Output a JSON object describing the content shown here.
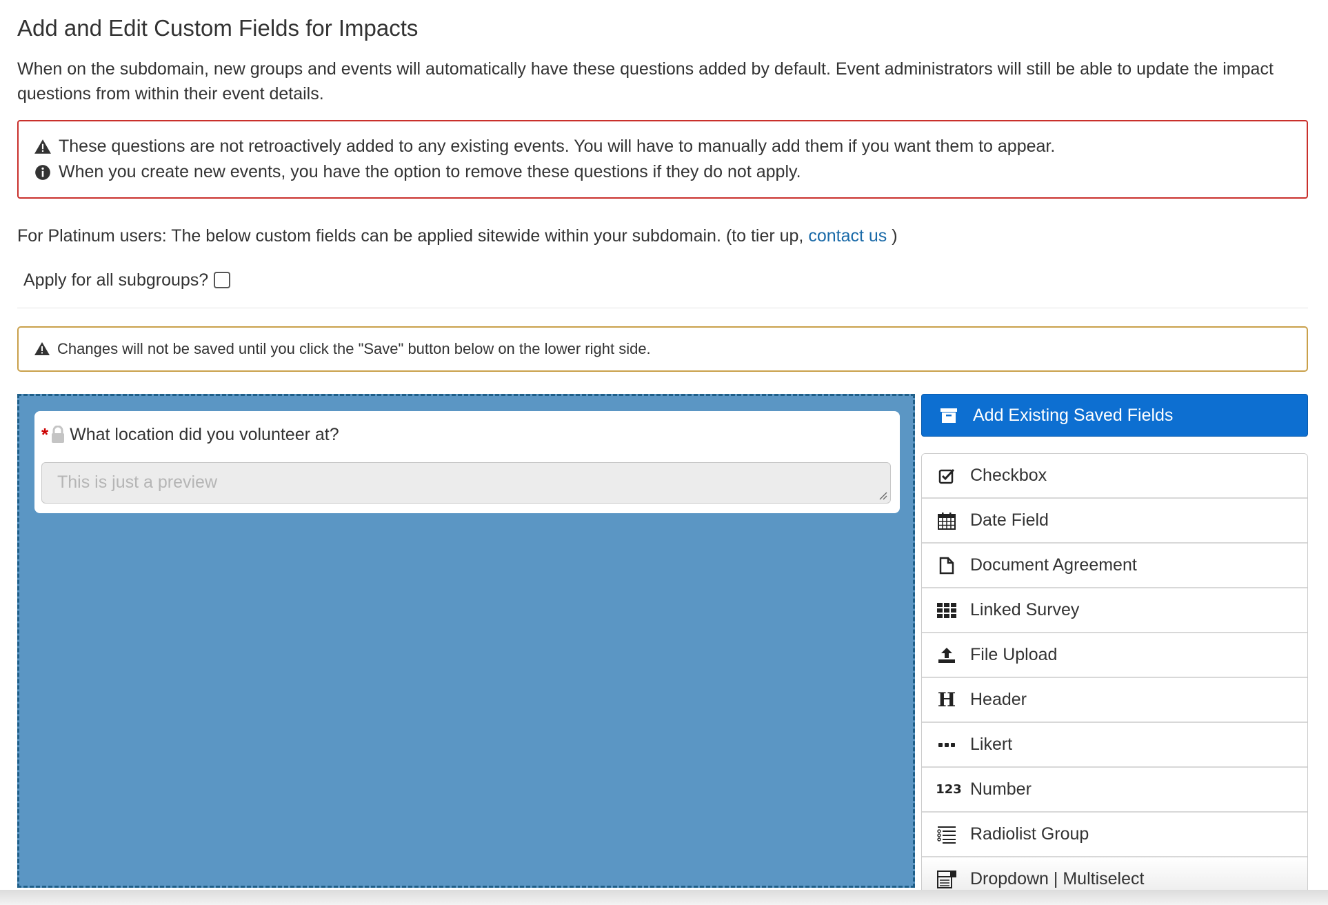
{
  "page": {
    "title": "Add and Edit Custom Fields for Impacts",
    "intro": "When on the subdomain, new groups and events will automatically have these questions added by default. Event administrators will still be able to update the impact questions from within their event details."
  },
  "notice": {
    "line1": "These questions are not retroactively added to any existing events. You will have to manually add them if you want them to appear.",
    "line2": "When you create new events, you have the option to remove these questions if they do not apply."
  },
  "platinum": {
    "text": "For Platinum users: The below custom fields can be applied sitewide within your subdomain. (to tier up,",
    "link": "contact us",
    "close": ")"
  },
  "apply_subgroups": {
    "label": "Apply for all subgroups?",
    "checked": false
  },
  "save_warning": "Changes will not be saved until you click the \"Save\" button below on the lower right side.",
  "canvas": {
    "field": {
      "label": "What location did you volunteer at?",
      "required_mark": "*",
      "placeholder": "This is just a preview"
    }
  },
  "sidebar": {
    "add_existing": "Add Existing Saved Fields",
    "items": [
      {
        "label": "Checkbox",
        "icon": "checkbox-icon"
      },
      {
        "label": "Date Field",
        "icon": "calendar-icon"
      },
      {
        "label": "Document Agreement",
        "icon": "document-icon"
      },
      {
        "label": "Linked Survey",
        "icon": "grid-icon"
      },
      {
        "label": "File Upload",
        "icon": "upload-icon"
      },
      {
        "label": "Header",
        "icon": "header-icon"
      },
      {
        "label": "Likert",
        "icon": "ellipsis-icon"
      },
      {
        "label": "Number",
        "icon": "number-icon"
      },
      {
        "label": "Radiolist Group",
        "icon": "list-icon"
      },
      {
        "label": "Dropdown | Multiselect",
        "icon": "dropdown-icon"
      }
    ],
    "number_icon_text": "123",
    "header_icon_text": "H"
  },
  "colors": {
    "canvas_bg": "#5b96c4",
    "primary_button": "#0d6fd1",
    "danger_border": "#c9302c",
    "warning_border": "#c9a04a",
    "link": "#1a6aa8"
  }
}
